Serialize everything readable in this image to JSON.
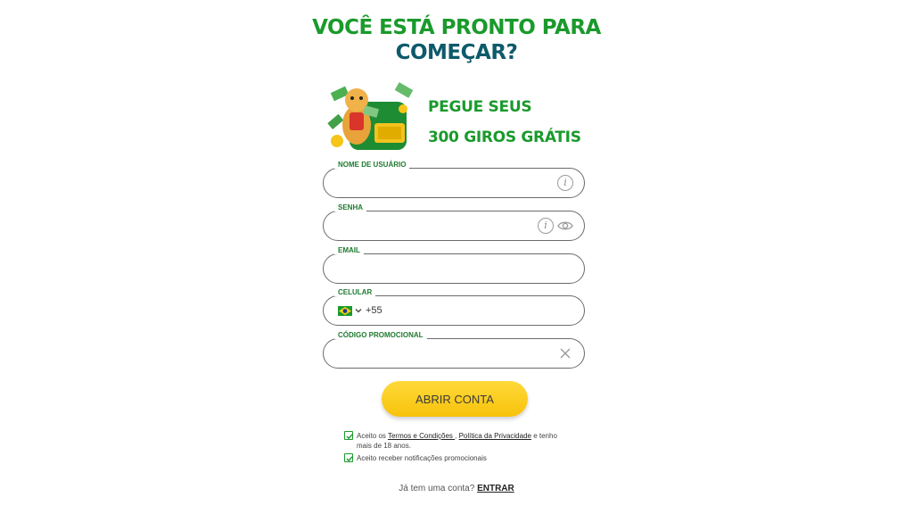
{
  "header": {
    "title_line1": "VOCÊ ESTÁ PRONTO PARA",
    "title_line2": "COMEÇAR?"
  },
  "promo": {
    "line1": "PEGUE SEUS",
    "line2": "300 GIROS GRÁTIS",
    "image": "tiger-with-money-illustration"
  },
  "form": {
    "username": {
      "label": "NOME DE USUÁRIO",
      "value": "",
      "icon": "info-icon"
    },
    "password": {
      "label": "SENHA",
      "value": "",
      "icons": [
        "info-icon",
        "eye-icon"
      ]
    },
    "email": {
      "label": "EMAIL",
      "value": ""
    },
    "phone": {
      "label": "CELULAR",
      "country_flag": "brazil-flag",
      "prefix": "+55",
      "value": ""
    },
    "promo_code": {
      "label": "CÓDIGO PROMOCIONAL",
      "value": "",
      "icon": "close-icon"
    },
    "submit_label": "ABRIR CONTA"
  },
  "consents": {
    "terms": {
      "checked": true,
      "prefix": "Aceito os ",
      "terms_link": "Termos e Condições ",
      "separator": ", ",
      "privacy_link": "Política da Privacidade",
      "suffix": " e tenho mais de 18 anos."
    },
    "notifications": {
      "checked": true,
      "text": "Aceito receber notificações promocionais"
    }
  },
  "footer": {
    "question": "Já tem uma conta? ",
    "login_link": "ENTRAR"
  },
  "colors": {
    "brand_green": "#1a9a2c",
    "title_teal": "#0d5a6a",
    "cta_yellow": "#f7c20a"
  }
}
